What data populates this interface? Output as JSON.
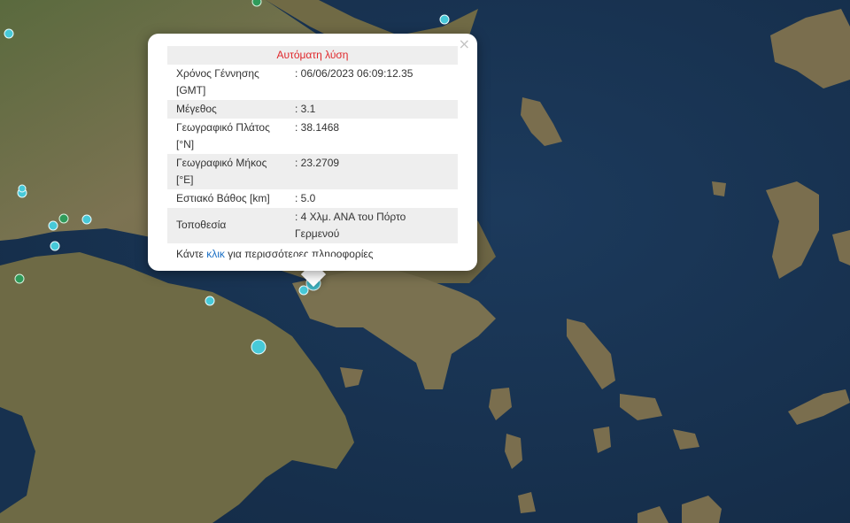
{
  "popup": {
    "title": "Αυτόματη λύση",
    "close_symbol": "×",
    "rows": [
      {
        "label": "Χρόνος Γέννησης [GMT]",
        "value": ": 06/06/2023 06:09:12.35"
      },
      {
        "label": "Μέγεθος",
        "value": ": 3.1"
      },
      {
        "label": "Γεωγραφικό Πλάτος [°N]",
        "value": ": 38.1468"
      },
      {
        "label": "Γεωγραφικό Μήκος [°E]",
        "value": ": 23.2709"
      },
      {
        "label": "Εστιακό Βάθος [km]",
        "value": ": 5.0"
      },
      {
        "label": "Τοποθεσία",
        "value": ": 4 Χλμ. ΑΝΑ του Πόρτο Γερμενού"
      }
    ],
    "more_prefix": "Κάντε",
    "more_link": "κλικ",
    "more_suffix": "για περισσότερες πληροφορίες"
  },
  "map": {
    "colors": {
      "sea": "#17314f",
      "land": "#6b6a47",
      "marker_cyan": "#47c9d8",
      "marker_green": "#2f9a5a"
    },
    "markers": [
      {
        "type": "cyan",
        "label": ""
      },
      {
        "type": "cyan",
        "label": ""
      },
      {
        "type": "cyan",
        "label": ""
      },
      {
        "type": "green",
        "label": ""
      }
    ]
  }
}
